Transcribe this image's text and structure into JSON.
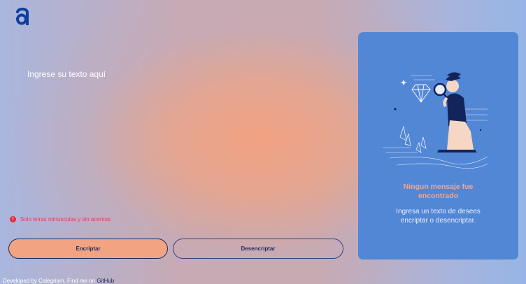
{
  "logo": {
    "icon": "alura-logo-icon",
    "color": "#0b3fa0"
  },
  "input": {
    "placeholder": "Ingrese su texto aquí"
  },
  "warning": {
    "icon": "exclamation-icon",
    "text": "Solo letras minusculas y sin acentos"
  },
  "buttons": {
    "encrypt": "Encriptar",
    "decrypt": "Desencriptar"
  },
  "panel": {
    "title": "Ningun mensaje fue encontrado",
    "text": "Ingresa un texto de desees encriptar o desencriptar.",
    "illustration": "person-with-magnifier-illustration"
  },
  "footer": {
    "text": "Developed by Calegriam. Find me on",
    "link": "GitHub"
  },
  "colors": {
    "accent": "#f2a482",
    "panel": "#5287d6",
    "dark": "#1f2d5c",
    "warning": "#e5293f"
  }
}
